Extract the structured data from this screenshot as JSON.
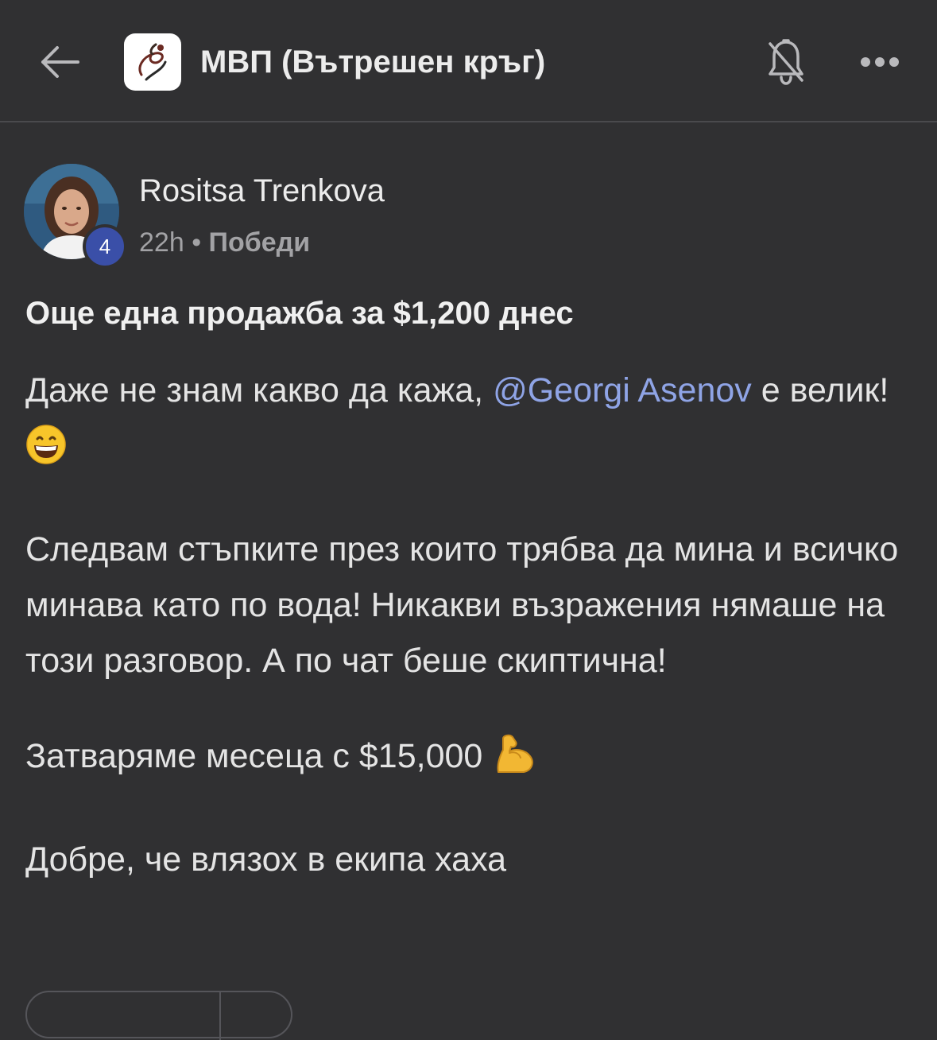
{
  "header": {
    "title": "МВП (Вътрешен кръг)",
    "back_icon": "arrow-left-icon",
    "notification_icon": "bell-muted-icon",
    "more_icon": "more-horizontal-icon"
  },
  "post": {
    "author": {
      "name": "Rositsa Trenkova",
      "level": "4"
    },
    "time": "22h",
    "separator": "•",
    "category": "Победи",
    "title": "Още една продажба за $1,200 днес",
    "paragraph1_before": "Даже не знам какво да кажа, ",
    "mention": "@Georgi Asenov",
    "paragraph1_after": " е велик!",
    "paragraph1_emoji": "grinning-face-emoji",
    "paragraph2": "Следвам стъпките през които трябва да мина и всичко минава като по вода! Никакви възражения нямаше на този разговор. А по чат беше скиптична!",
    "paragraph3": "Затваряме месеца с $15,000",
    "paragraph3_emoji": "flexed-biceps-emoji",
    "paragraph4": "Добре, че влязох в екипа хаха"
  },
  "colors": {
    "background": "#303032",
    "mention": "#8fa4e6",
    "badge": "#3a4fa8",
    "divider": "#4a4a4d"
  }
}
